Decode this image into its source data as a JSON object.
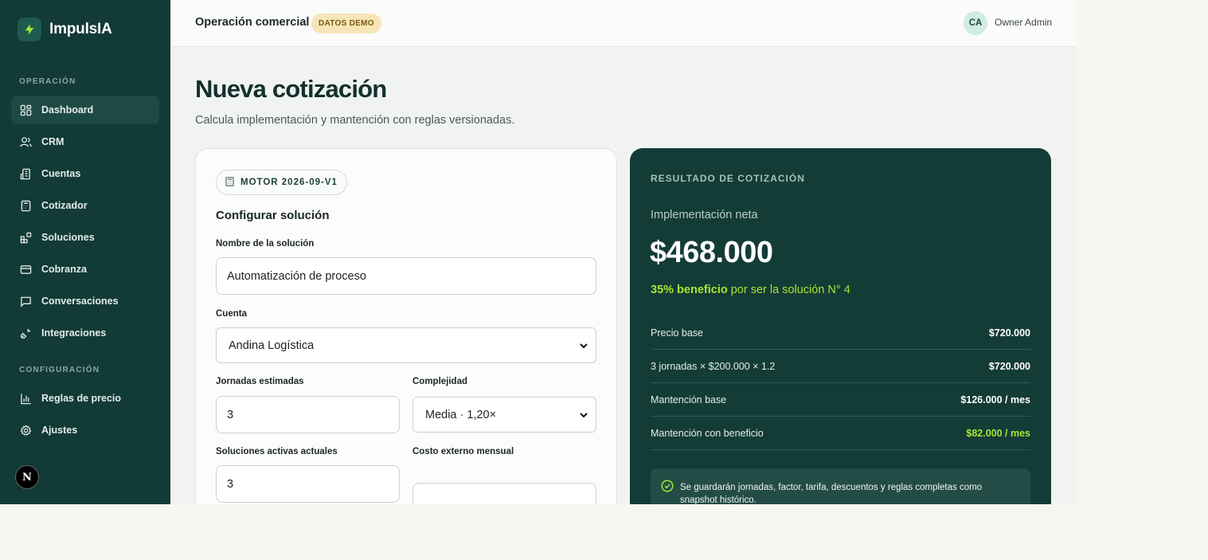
{
  "brand": {
    "name": "ImpulsIA",
    "logo_icon": "bolt-icon"
  },
  "sidebar": {
    "section_operacion": "OPERACIÓN",
    "section_configuracion": "CONFIGURACIÓN",
    "items": [
      {
        "label": "Dashboard",
        "icon": "dashboard-icon",
        "active": true
      },
      {
        "label": "CRM",
        "icon": "users-icon"
      },
      {
        "label": "Cuentas",
        "icon": "building-icon"
      },
      {
        "label": "Cotizador",
        "icon": "calculator-icon"
      },
      {
        "label": "Soluciones",
        "icon": "blocks-icon"
      },
      {
        "label": "Cobranza",
        "icon": "credit-card-icon"
      },
      {
        "label": "Conversaciones",
        "icon": "chat-icon"
      },
      {
        "label": "Integraciones",
        "icon": "plug-icon"
      }
    ],
    "config_items": [
      {
        "label": "Reglas de precio",
        "icon": "chart-bars-icon"
      },
      {
        "label": "Ajustes",
        "icon": "gear-icon"
      }
    ],
    "bottom_badge": "N"
  },
  "header": {
    "title": "Operación comercial",
    "badge": "DATOS DEMO",
    "avatar_initials": "CA",
    "user_name": "Owner Admin"
  },
  "page": {
    "title": "Nueva cotización",
    "subtitle": "Calcula implementación y mantención con reglas versionadas."
  },
  "form": {
    "engine_pill": "MOTOR 2026-09-V1",
    "heading": "Configurar solución",
    "solution_name_label": "Nombre de la solución",
    "solution_name_value": "Automatización de proceso",
    "account_label": "Cuenta",
    "account_value": "Andina Logística",
    "days_label": "Jornadas estimadas",
    "days_value": "3",
    "complexity_label": "Complejidad",
    "complexity_value": "Media · 1,20×",
    "active_solutions_label": "Soluciones activas actuales",
    "active_solutions_value": "3",
    "external_cost_label": "Costo externo mensual",
    "external_cost_value": ""
  },
  "result": {
    "label": "RESULTADO DE COTIZACIÓN",
    "subtitle": "Implementación neta",
    "amount": "$468.000",
    "benefit_strong": "35% beneficio",
    "benefit_rest": " por ser la solución N° 4",
    "rows": [
      {
        "label": "Precio base",
        "value": "$720.000"
      },
      {
        "label": "3 jornadas × $200.000 × 1.2",
        "value": "$720.000"
      },
      {
        "label": "Mantención base",
        "value": "$126.000 / mes"
      },
      {
        "label": "Mantención con beneficio",
        "value": "$82.000 / mes"
      }
    ],
    "note": "Se guardarán jornadas, factor, tarifa, descuentos y reglas completas como snapshot histórico."
  },
  "colors": {
    "sidebar_bg": "#123a36",
    "result_bg": "#143c37",
    "accent_green": "#a3e635",
    "demo_badge_bg": "#f6e5b6"
  }
}
